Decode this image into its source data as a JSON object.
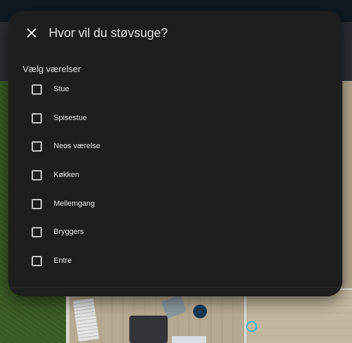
{
  "dialog": {
    "title": "Hvor vil du støvsuge?",
    "close_icon": "close-icon",
    "section_label": "Vælg værelser",
    "rooms": [
      {
        "label": "Stue",
        "checked": false
      },
      {
        "label": "Spisestue",
        "checked": false
      },
      {
        "label": "Neos værelse",
        "checked": false
      },
      {
        "label": "Køkken",
        "checked": false
      },
      {
        "label": "Mellemgang",
        "checked": false
      },
      {
        "label": "Bryggers",
        "checked": false
      },
      {
        "label": "Entre",
        "checked": false
      }
    ]
  },
  "colors": {
    "dialog_background": "#1e1e1e",
    "text": "#e1e1e1",
    "checkbox_border": "#c8c8c8",
    "top_bar": "#111a22"
  }
}
